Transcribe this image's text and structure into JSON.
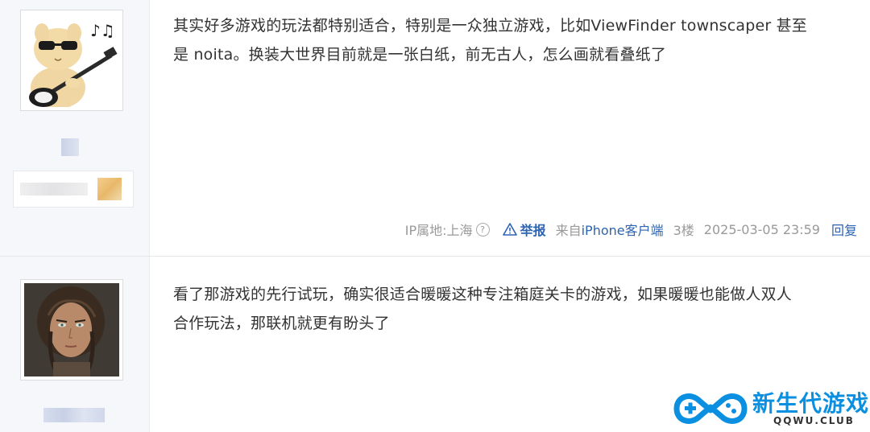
{
  "posts": [
    {
      "avatar": "cat-with-guitar-sunglasses",
      "content_line1": "其实好多游戏的玩法都特别适合，特别是一众独立游戏，比如ViewFinder townscaper 甚至",
      "content_line2": "是 noita。换装大世界目前就是一张白纸，前无古人，怎么画就看叠纸了",
      "meta": {
        "ip_location": "IP属地:上海",
        "help_icon": "question-circle-icon",
        "report_label": "举报",
        "source_prefix": "来自",
        "source_link": "iPhone客户端",
        "floor": "3楼",
        "timestamp": "2025-03-05 23:59",
        "reply_label": "回复"
      }
    },
    {
      "avatar": "painted-portrait-woman",
      "content_line1": "看了那游戏的先行试玩，确实很适合暖暖这种专注箱庭关卡的游戏，如果暖暖也能做人双人",
      "content_line2": "合作玩法，那联机就更有盼头了"
    }
  ],
  "watermark": {
    "title": "新生代游戏",
    "subtitle": "QQWU.CLUB",
    "icon": "gamepad-icon"
  },
  "colors": {
    "link_blue": "#2d64b3",
    "meta_gray": "#999999",
    "sidebar_bg": "#f6f7fb",
    "watermark_blue": "#0b8fe0"
  }
}
